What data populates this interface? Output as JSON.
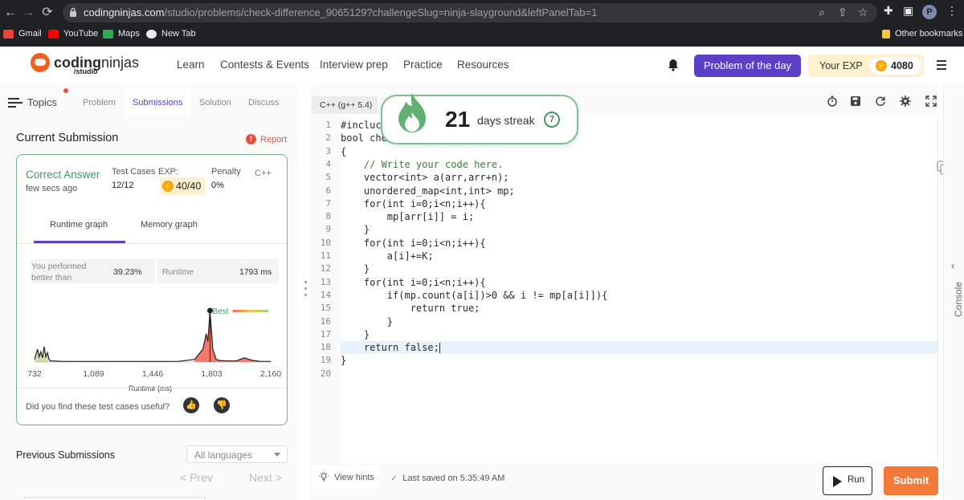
{
  "browser": {
    "url_host": "codingninjas.com",
    "url_path": "/studio/problems/check-difference_9065129?challengeSlug=ninja-slayground&leftPanelTab=1",
    "profile_initial": "P",
    "bookmarks": [
      "Gmail",
      "YouTube",
      "Maps",
      "New Tab"
    ],
    "other_bookmarks": "Other bookmarks"
  },
  "header": {
    "logo_bold": "coding",
    "logo_light": "ninjas",
    "logo_sub": "/studio",
    "nav": [
      "Learn",
      "Contests & Events",
      "Interview prep",
      "Practice",
      "Resources"
    ],
    "potd_label": "Problem of the day",
    "exp_label": "Your EXP",
    "exp_value": "4080"
  },
  "left": {
    "topics": "Topics",
    "tabs": [
      "Problem",
      "Submissions",
      "Solution",
      "Discuss"
    ],
    "current_title": "Current Submission",
    "report": "Report",
    "status": "Correct Answer",
    "when": "few secs ago",
    "test_cases_label": "Test Cases",
    "test_cases_value": "12/12",
    "exp_label": "EXP:",
    "exp_value": "40/40",
    "penalty_label": "Penalty",
    "penalty_value": "0%",
    "language": "C++",
    "graph_tabs": [
      "Runtime graph",
      "Memory graph"
    ],
    "performed_label": "You performed better than",
    "performed_value": "39.23%",
    "runtime_label": "Runtime",
    "runtime_value": "1793 ms",
    "useful_q": "Did you find these test cases useful?",
    "prev_title": "Previous Submissions",
    "lang_filter": "All languages",
    "prev_btn": "< Prev",
    "next_btn": "Next >"
  },
  "chart_data": {
    "type": "area",
    "xlabel": "Runtime (ms)",
    "x_ticks": [
      "732",
      "1,089",
      "1,446",
      "1,803",
      "2,160"
    ],
    "marker_label": "Best",
    "highlight_x": 1793,
    "series": [
      {
        "x": [
          732,
          750,
          760,
          770,
          780,
          790,
          800,
          810,
          820,
          830,
          850,
          900,
          1000,
          1100,
          1200,
          1300,
          1400,
          1500,
          1600,
          1700,
          1750,
          1770,
          1780,
          1793,
          1810,
          1830,
          1850,
          1900,
          1950,
          2000,
          2050,
          2100,
          2160
        ],
        "y": [
          0.05,
          0.25,
          0.1,
          0.2,
          0.08,
          0.3,
          0.1,
          0.18,
          0.05,
          0.02,
          0.02,
          0.01,
          0.01,
          0.01,
          0.01,
          0.01,
          0.01,
          0.01,
          0.01,
          0.05,
          0.25,
          0.55,
          0.4,
          1.0,
          0.25,
          0.05,
          0.03,
          0.02,
          0.02,
          0.08,
          0.03,
          0.01,
          0.01
        ]
      }
    ],
    "colors": {
      "low": "#c7d89b",
      "high": "#f26b5b",
      "marker": "#222222"
    }
  },
  "editor": {
    "language": "C++ (g++ 5.4)",
    "lines": [
      "#incluc",
      "bool che",
      "{",
      "    // Write your code here.",
      "    vector<int> a(arr,arr+n);",
      "    unordered_map<int,int> mp;",
      "    for(int i=0;i<n;i++){",
      "        mp[arr[i]] = i;",
      "    }",
      "    for(int i=0;i<n;i++){",
      "        a[i]+=K;",
      "    }",
      "    for(int i=0;i<n;i++){",
      "        if(mp.count(a[i])>0 && i != mp[a[i]]){",
      "            return true;",
      "        }",
      "    }",
      "    return false;",
      "}",
      ""
    ],
    "highlight_line": 18,
    "hints_label": "View hints",
    "saved_text": "Last saved on 5:35:49 AM",
    "run_label": "Run",
    "submit_label": "Submit"
  },
  "streak": {
    "days": "21",
    "label": "days streak",
    "badge": "7"
  },
  "console_label": "Console",
  "colors": {
    "accent_purple": "#5b3fc4",
    "success_green": "#3e9b5f",
    "submit_orange": "#f47a3a",
    "danger_red": "#e5533d"
  }
}
